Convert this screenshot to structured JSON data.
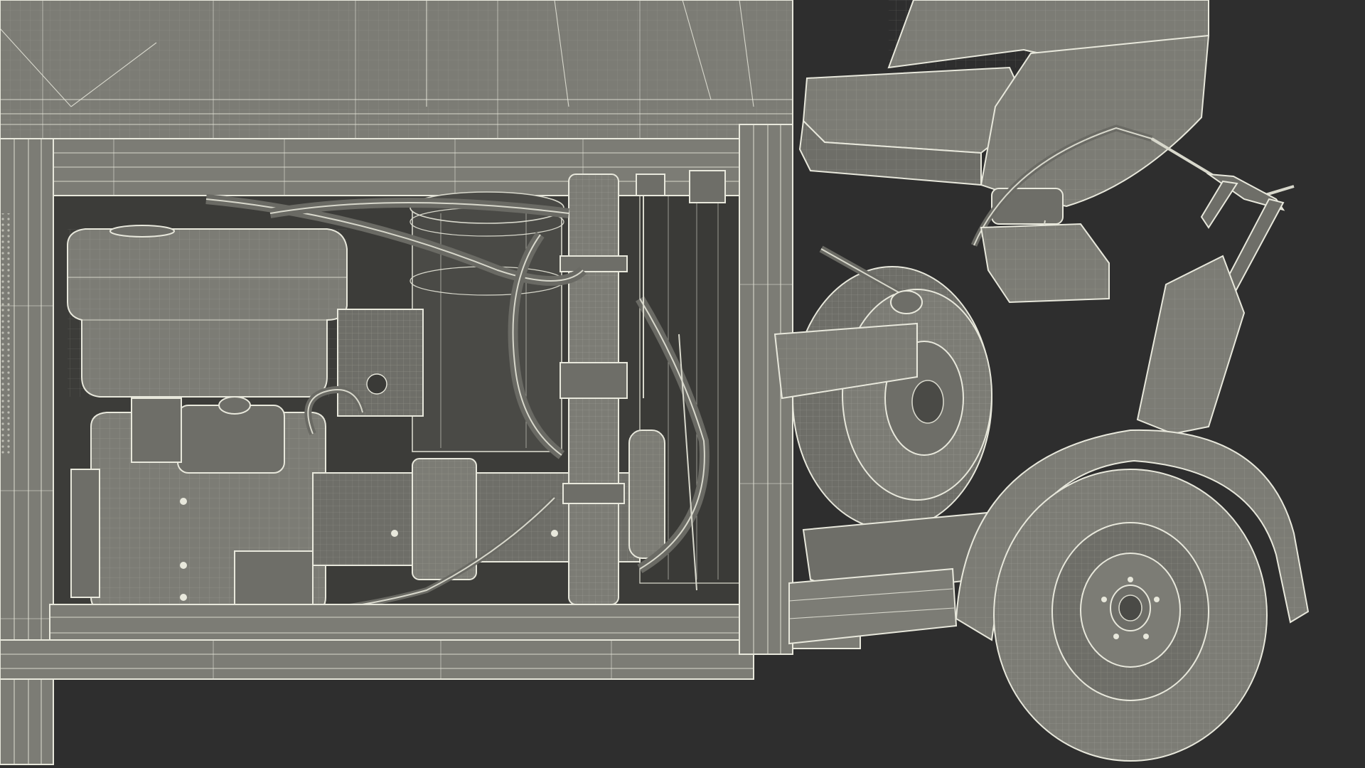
{
  "scene": {
    "subject": "wireframe-render",
    "background_color": "#2e2e2e",
    "mesh_color": "#7c7c75",
    "wire_color": "#e8e8dc"
  }
}
